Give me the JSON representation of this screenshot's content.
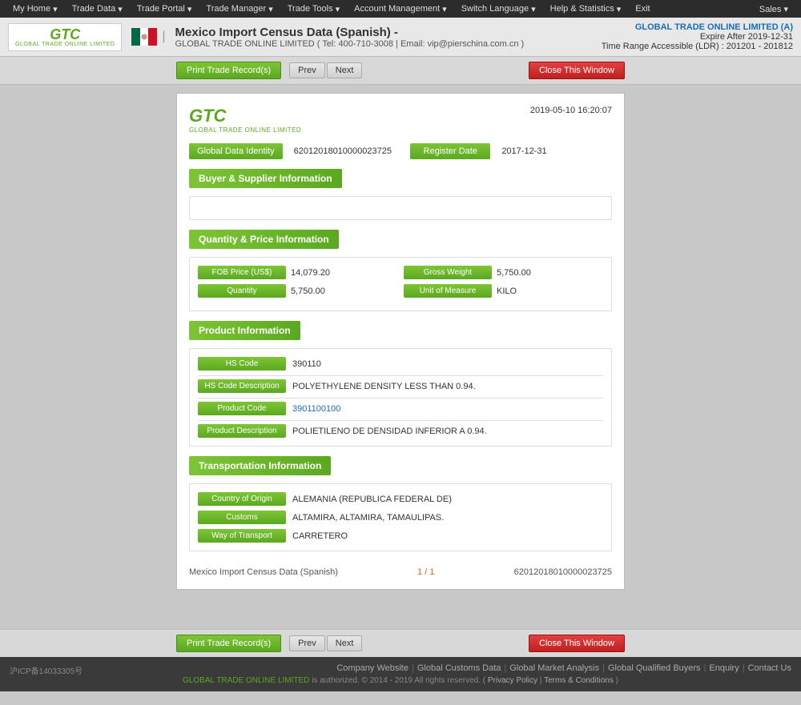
{
  "topnav": {
    "items": [
      {
        "label": "My Home",
        "hasArrow": true
      },
      {
        "label": "Trade Data",
        "hasArrow": true
      },
      {
        "label": "Trade Portal",
        "hasArrow": true
      },
      {
        "label": "Trade Manager",
        "hasArrow": true
      },
      {
        "label": "Trade Tools",
        "hasArrow": true
      },
      {
        "label": "Account Management",
        "hasArrow": true
      },
      {
        "label": "Switch Language",
        "hasArrow": true
      },
      {
        "label": "Help & Statistics",
        "hasArrow": true
      },
      {
        "label": "Exit",
        "hasArrow": false
      }
    ],
    "sales": "Sales"
  },
  "header": {
    "logo_text": "GTC",
    "logo_sub": "GLOBAL TRADE ONLINE LIMITED",
    "page_title": "Mexico Import Census Data (Spanish)  -",
    "page_subtitle": "GLOBAL TRADE ONLINE LIMITED ( Tel: 400-710-3008 | Email: vip@pierschina.com.cn )",
    "account_name": "GLOBAL TRADE ONLINE LIMITED (A)",
    "expire": "Expire After 2019-12-31",
    "ldr": "Time Range Accessible (LDR) : 201201 - 201812"
  },
  "toolbar": {
    "print_label": "Print Trade Record(s)",
    "prev_label": "Prev",
    "next_label": "Next",
    "close_label": "Close This Window"
  },
  "record": {
    "datetime": "2019-05-10 16:20:07",
    "global_data_identity_label": "Global Data Identity",
    "global_data_identity_value": "62012018010000023725",
    "register_date_label": "Register Date",
    "register_date_value": "2017-12-31",
    "sections": {
      "buyer_supplier": {
        "title": "Buyer & Supplier Information"
      },
      "quantity_price": {
        "title": "Quantity & Price Information",
        "fob_price_label": "FOB Price (US$)",
        "fob_price_value": "14,079.20",
        "gross_weight_label": "Gross Weight",
        "gross_weight_value": "5,750.00",
        "quantity_label": "Quantity",
        "quantity_value": "5,750.00",
        "unit_of_measure_label": "Unit of Measure",
        "unit_of_measure_value": "KILO"
      },
      "product": {
        "title": "Product Information",
        "hs_code_label": "HS Code",
        "hs_code_value": "390110",
        "hs_code_desc_label": "HS Code Description",
        "hs_code_desc_value": "POLYETHYLENE DENSITY LESS THAN 0.94.",
        "product_code_label": "Product Code",
        "product_code_value": "3901100100",
        "product_desc_label": "Product Description",
        "product_desc_value": "POLIETILENO DE DENSIDAD INFERIOR A 0.94."
      },
      "transportation": {
        "title": "Transportation Information",
        "country_of_origin_label": "Country of Origin",
        "country_of_origin_value": "ALEMANIA (REPUBLICA FEDERAL DE)",
        "customs_label": "Customs",
        "customs_value": "ALTAMIRA, ALTAMIRA, TAMAULIPAS.",
        "way_of_transport_label": "Way of Transport",
        "way_of_transport_value": "CARRETERO"
      }
    },
    "footer": {
      "record_name": "Mexico Import Census Data (Spanish)",
      "page_indicator": "1 / 1",
      "record_id": "62012018010000023725"
    }
  },
  "footer": {
    "icp": "沪ICP备14033305号",
    "links": [
      "Company Website",
      "Global Customs Data",
      "Global Market Analysis",
      "Global Qualified Buyers",
      "Enquiry",
      "Contact Us"
    ],
    "copyright": "GLOBAL TRADE ONLINE LIMITED is authorized. © 2014 - 2019 All rights reserved.  (",
    "privacy_policy": "Privacy Policy",
    "separator": "|",
    "terms": "Terms & Conditions",
    "copyright_end": ")"
  }
}
